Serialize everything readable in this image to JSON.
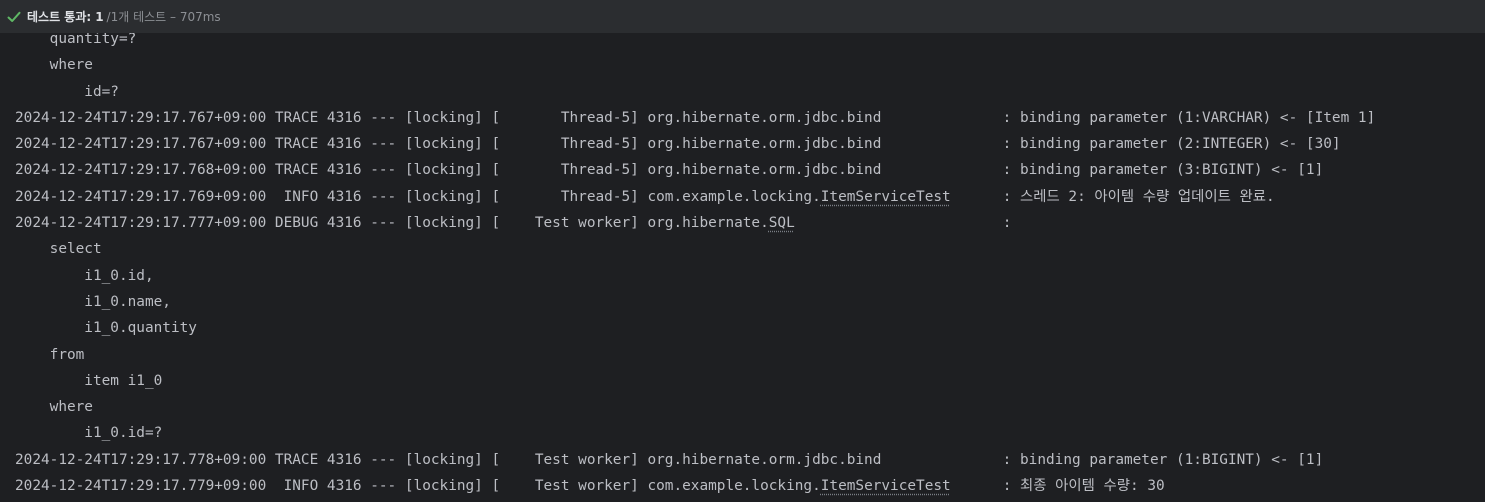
{
  "header": {
    "status_label": "테스트 통과:",
    "status_count": "1",
    "status_detail": "/1개 테스트 – 707ms",
    "status_icon": "check-icon",
    "accent_color": "#5fb865"
  },
  "console": {
    "lines": [
      {
        "text": "    quantity=?"
      },
      {
        "text": "    where"
      },
      {
        "text": "        id=?"
      },
      {
        "text": "2024-12-24T17:29:17.767+09:00 TRACE 4316 --- [locking] [       Thread-5] org.hibernate.orm.jdbc.bind              : binding parameter (1:VARCHAR) <- [Item 1]"
      },
      {
        "text": "2024-12-24T17:29:17.767+09:00 TRACE 4316 --- [locking] [       Thread-5] org.hibernate.orm.jdbc.bind              : binding parameter (2:INTEGER) <- [30]"
      },
      {
        "text": "2024-12-24T17:29:17.768+09:00 TRACE 4316 --- [locking] [       Thread-5] org.hibernate.orm.jdbc.bind              : binding parameter (3:BIGINT) <- [1]"
      },
      {
        "pre": "2024-12-24T17:29:17.769+09:00  INFO 4316 --- [locking] [       Thread-5] com.example.locking.",
        "link": "ItemServiceTest",
        "post": "      : 스레드 2: 아이템 수량 업데이트 완료."
      },
      {
        "pre": "2024-12-24T17:29:17.777+09:00 DEBUG 4316 --- [locking] [    Test worker] org.hibernate.",
        "link": "SQL",
        "post": "                        :"
      },
      {
        "text": "    select"
      },
      {
        "text": "        i1_0.id,"
      },
      {
        "text": "        i1_0.name,"
      },
      {
        "text": "        i1_0.quantity"
      },
      {
        "text": "    from"
      },
      {
        "text": "        item i1_0"
      },
      {
        "text": "    where"
      },
      {
        "text": "        i1_0.id=?"
      },
      {
        "text": "2024-12-24T17:29:17.778+09:00 TRACE 4316 --- [locking] [    Test worker] org.hibernate.orm.jdbc.bind              : binding parameter (1:BIGINT) <- [1]"
      },
      {
        "pre": "2024-12-24T17:29:17.779+09:00  INFO 4316 --- [locking] [    Test worker] com.example.locking.",
        "link": "ItemServiceTest",
        "post": "      : 최종 아이템 수량: 30"
      }
    ]
  }
}
